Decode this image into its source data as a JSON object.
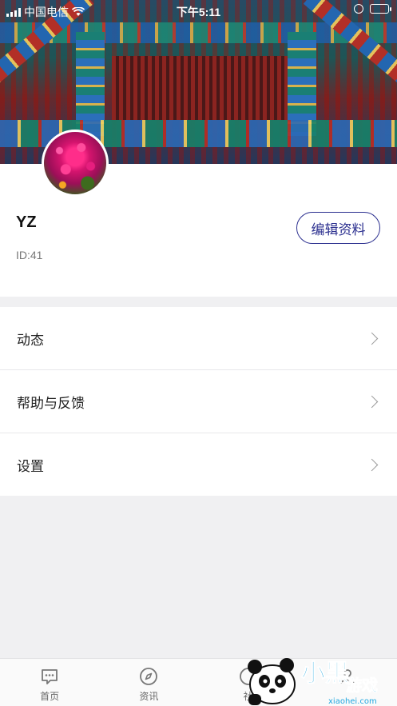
{
  "status_bar": {
    "carrier": "中国电信",
    "time": "下午5:11",
    "battery_color": "#4cd964"
  },
  "profile": {
    "name": "YZ",
    "id_text": "ID:41",
    "edit_label": "编辑资料",
    "accent": "#2b2f8f"
  },
  "menu": {
    "items": [
      {
        "label": "动态",
        "icon": "chevron-right-icon"
      },
      {
        "label": "帮助与反馈",
        "icon": "chevron-right-icon"
      },
      {
        "label": "设置",
        "icon": "chevron-right-icon"
      }
    ]
  },
  "tabbar": {
    "tabs": [
      {
        "label": "首页",
        "icon": "message-dots-icon"
      },
      {
        "label": "资讯",
        "icon": "compass-icon"
      },
      {
        "label": "社",
        "icon": "community-icon"
      },
      {
        "label": "",
        "icon": "profile-icon"
      }
    ]
  },
  "watermark": {
    "text": "小黑游戏",
    "url": "xiaohei.com"
  }
}
